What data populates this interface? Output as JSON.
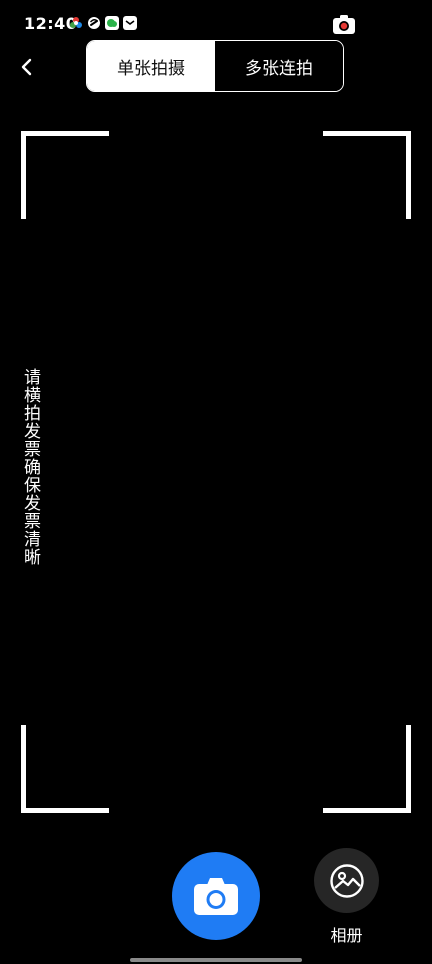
{
  "status_bar": {
    "time": "12:40",
    "icons": [
      "color-wheel-icon",
      "sync-icon",
      "wechat-icon",
      "message-icon"
    ],
    "recording_icon": "camera-record-icon"
  },
  "header": {
    "back_icon": "back-arrow-icon",
    "mode_tabs": [
      {
        "label": "单张拍摄",
        "active": true
      },
      {
        "label": "多张连拍",
        "active": false
      }
    ]
  },
  "viewfinder": {
    "hint": "请横拍发票确保发票清晰"
  },
  "controls": {
    "shutter_icon": "camera-icon",
    "album_icon": "gallery-icon",
    "album_label": "相册"
  },
  "colors": {
    "background": "#000000",
    "accent": "#1f7cf4",
    "album_bg": "#262626",
    "text": "#ffffff"
  }
}
